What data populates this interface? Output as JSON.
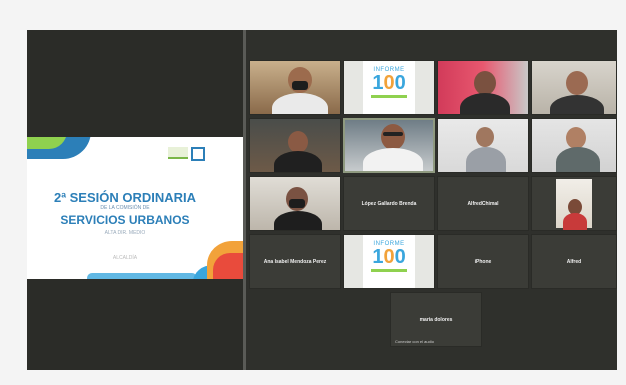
{
  "shared_slide": {
    "title_line1": "2ª SESIÓN ORDINARIA",
    "subtitle": "DE LA COMISIÓN DE",
    "title_line2": "SERVICIOS URBANOS",
    "small_text": "ALTA DIR. MEDIO",
    "date_text": "ALCALDÍA"
  },
  "informe_logo": {
    "label": "INFORME",
    "number_1": "1",
    "number_2": "0",
    "number_3": "0"
  },
  "participants": [
    {
      "id": "p1",
      "name": "",
      "kind": "video"
    },
    {
      "id": "p2",
      "name": "",
      "kind": "logo"
    },
    {
      "id": "p3",
      "name": "",
      "kind": "video"
    },
    {
      "id": "p4",
      "name": "",
      "kind": "video"
    },
    {
      "id": "p5",
      "name": "",
      "kind": "video"
    },
    {
      "id": "p6",
      "name": "",
      "kind": "video"
    },
    {
      "id": "p7",
      "name": "",
      "kind": "video"
    },
    {
      "id": "p8",
      "name": "",
      "kind": "video"
    },
    {
      "id": "p9",
      "name": "",
      "kind": "video"
    },
    {
      "id": "p10",
      "name": "López Gallardo Brenda",
      "kind": "name"
    },
    {
      "id": "p11",
      "name": "AlfredChimal",
      "kind": "name"
    },
    {
      "id": "p12",
      "name": "",
      "kind": "video"
    },
    {
      "id": "p13",
      "name": "Ana Isabel Mendoza Perez",
      "kind": "name"
    },
    {
      "id": "p14",
      "name": "",
      "kind": "logo"
    },
    {
      "id": "p15",
      "name": "iPhone",
      "kind": "name"
    },
    {
      "id": "p16",
      "name": "Alfred",
      "kind": "name"
    },
    {
      "id": "p17",
      "name": "maria dolores",
      "kind": "name"
    }
  ],
  "speaker_footer": "Conectar con el audio"
}
